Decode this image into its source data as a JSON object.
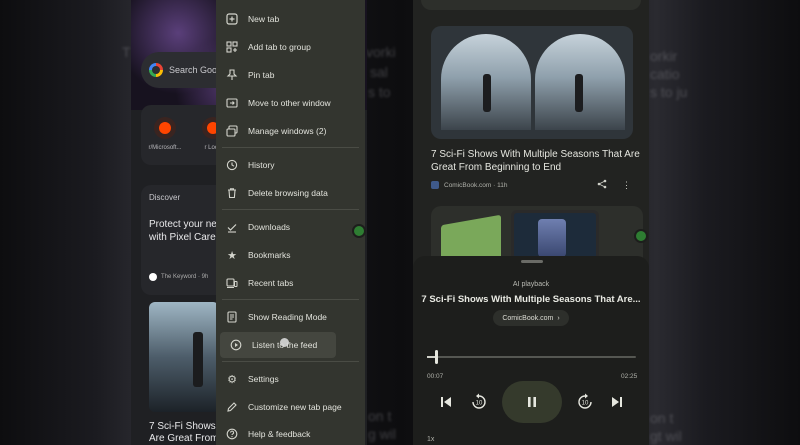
{
  "left_screen": {
    "search_placeholder": "Search Goo",
    "shortcuts": [
      {
        "label": "r/Microsoft..."
      },
      {
        "label": "r Loop"
      }
    ],
    "discover": {
      "title": "Discover",
      "headline_line1": "Protect your ne",
      "headline_line2": "with Pixel Care",
      "source": "The Keyword · 9h"
    },
    "card_headline_line1": "7 Sci-Fi Shows",
    "card_headline_line2": "Are Great From"
  },
  "menu": {
    "items": [
      {
        "label": "New tab",
        "icon": "new-tab-icon"
      },
      {
        "label": "Add tab to group",
        "icon": "add-to-group-icon"
      },
      {
        "label": "Pin tab",
        "icon": "pin-icon"
      },
      {
        "label": "Move to other window",
        "icon": "move-window-icon"
      },
      {
        "label": "Manage windows (2)",
        "icon": "windows-icon"
      },
      {
        "label": "History",
        "icon": "history-icon"
      },
      {
        "label": "Delete browsing data",
        "icon": "trash-icon"
      },
      {
        "label": "Downloads",
        "icon": "download-icon"
      },
      {
        "label": "Bookmarks",
        "icon": "star-icon"
      },
      {
        "label": "Recent tabs",
        "icon": "devices-icon"
      },
      {
        "label": "Show Reading Mode",
        "icon": "reading-mode-icon"
      },
      {
        "label": "Listen to the feed",
        "icon": "play-circle-icon"
      },
      {
        "label": "Settings",
        "icon": "gear-icon"
      },
      {
        "label": "Customize new tab page",
        "icon": "pencil-icon"
      },
      {
        "label": "Help & feedback",
        "icon": "help-icon"
      }
    ]
  },
  "right_screen": {
    "article": {
      "headline": "7 Sci-Fi Shows With Multiple Seasons That Are Great From Beginning to End",
      "source": "ComicBook.com · 11h"
    }
  },
  "player": {
    "label": "AI playback",
    "title": "7 Sci-Fi Shows With Multiple Seasons That Are...",
    "source_chip": "ComicBook.com",
    "current_time": "00:07",
    "total_time": "02:25",
    "progress": 0.04,
    "skip_back_seconds": "10",
    "skip_forward_seconds": "10",
    "speed": "1x"
  },
  "background_text": {
    "l1": "T",
    "l2": "vorki",
    "l3": "sal",
    "l4": "s to",
    "r1": "orkir",
    "r2": "catio",
    "r3": "s to ju",
    "b1": "on t",
    "b2": "g wil",
    "rb1": "on t",
    "rb2": "gt wil"
  }
}
